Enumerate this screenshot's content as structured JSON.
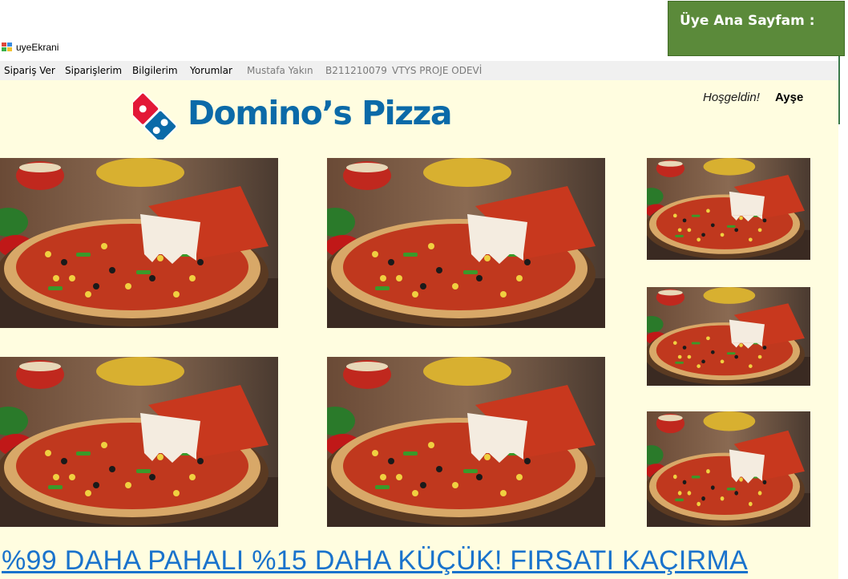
{
  "page_label": "Üye Ana Sayfam :",
  "window": {
    "title": "uyeEkrani"
  },
  "menu": [
    {
      "label": "Sipariş Ver"
    },
    {
      "label": "Siparişlerim"
    },
    {
      "label": "Bilgilerim"
    },
    {
      "label": "Yorumlar"
    },
    {
      "label": "Mustafa Yakın"
    },
    {
      "label": "B211210079"
    },
    {
      "label": "VTYS PROJE ODEVİ"
    }
  ],
  "welcome": {
    "text": "Hoşgeldin!",
    "name": "Ayşe"
  },
  "logo": {
    "text": "Domino’s Pizza"
  },
  "banner": {
    "text": "%99 DAHA PAHALI %15 DAHA KÜÇÜK! FIRSATI KAÇIRMA"
  },
  "colors": {
    "client_bg": "#fffde0",
    "brand_blue": "#0b6aa8",
    "brand_red": "#e31837",
    "banner_link": "#1a73cc",
    "label_green": "#5b8a3a"
  },
  "icons": {
    "app": "window-app-icon",
    "logo": "domino-tile-icon"
  }
}
